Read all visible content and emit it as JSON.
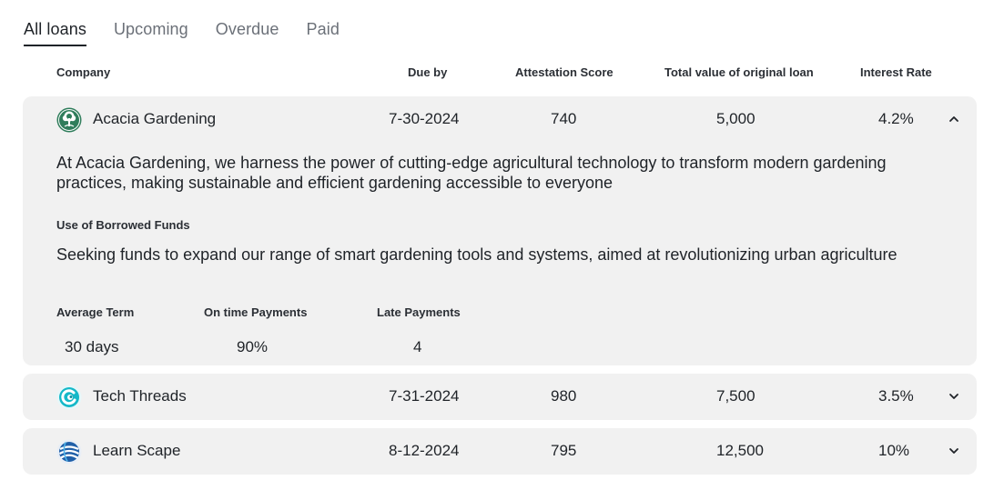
{
  "tabs": [
    {
      "label": "All loans",
      "active": true
    },
    {
      "label": "Upcoming",
      "active": false
    },
    {
      "label": "Overdue",
      "active": false
    },
    {
      "label": "Paid",
      "active": false
    }
  ],
  "columns": {
    "company": "Company",
    "due_by": "Due by",
    "attestation_score": "Attestation Score",
    "total_value": "Total value of original loan",
    "interest_rate": "Interest Rate"
  },
  "loans": [
    {
      "company": "Acacia Gardening",
      "logo_icon": "tree-logo-icon",
      "due_by": "7-30-2024",
      "attestation_score": "740",
      "total_value": "5,000",
      "interest_rate": "4.2%",
      "expanded": true,
      "description": "At Acacia Gardening, we harness the power of cutting-edge agricultural technology to transform modern gardening practices, making sustainable and efficient gardening accessible to everyone",
      "use_of_funds_label": "Use of Borrowed Funds",
      "use_of_funds": "Seeking funds to expand our range of smart gardening tools and systems, aimed at revolutionizing urban agriculture",
      "stats_labels": {
        "average_term": "Average Term",
        "on_time": "On time Payments",
        "late": "Late Payments"
      },
      "stats": {
        "average_term": "30 days",
        "on_time": "90%",
        "late": "4"
      }
    },
    {
      "company": "Tech Threads",
      "logo_icon": "swirl-logo-icon",
      "due_by": "7-31-2024",
      "attestation_score": "980",
      "total_value": "7,500",
      "interest_rate": "3.5%",
      "expanded": false
    },
    {
      "company": "Learn Scape",
      "logo_icon": "globe-logo-icon",
      "due_by": "8-12-2024",
      "attestation_score": "795",
      "total_value": "12,500",
      "interest_rate": "10%",
      "expanded": false
    }
  ],
  "colors": {
    "card_bg": "#f1f1f1",
    "text": "#1f2328",
    "muted_tab": "#6b7078",
    "acacia_green": "#2f7d5b",
    "tech_teal": "#14b8c8",
    "learn_blue": "#1f5fa8"
  }
}
